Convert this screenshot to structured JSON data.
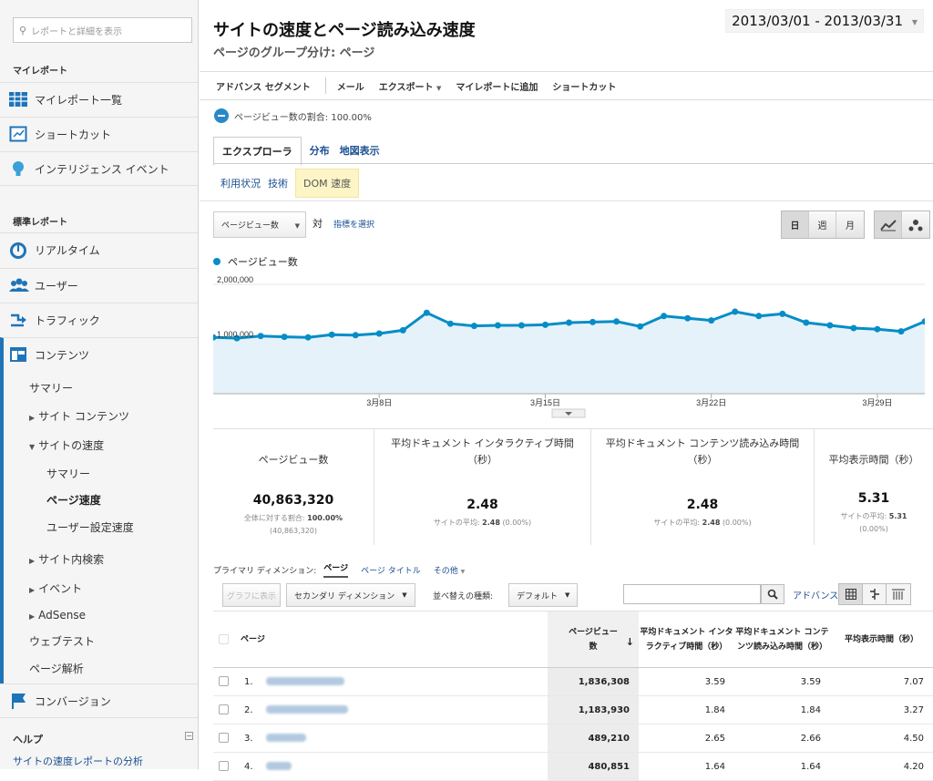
{
  "sidebar": {
    "search_placeholder": "レポートと詳細を表示",
    "my_reports_header": "マイレポート",
    "my_reports_items": [
      {
        "label": "マイレポート一覧"
      },
      {
        "label": "ショートカット"
      },
      {
        "label": "インテリジェンス イベント"
      }
    ],
    "standard_header": "標準レポート",
    "standard_items": [
      {
        "label": "リアルタイム"
      },
      {
        "label": "ユーザー"
      },
      {
        "label": "トラフィック"
      },
      {
        "label": "コンテンツ"
      }
    ],
    "content_sub": {
      "summary": "サマリー",
      "site_content": "サイト コンテンツ",
      "site_speed": "サイトの速度",
      "speed_summary": "サマリー",
      "page_speed": "ページ速度",
      "user_timings": "ユーザー設定速度",
      "site_search": "サイト内検索",
      "events": "イベント",
      "adsense": "AdSense",
      "experiments": "ウェブテスト",
      "inpage": "ページ解析"
    },
    "conversions": "コンバージョン",
    "help_header": "ヘルプ",
    "help_link": "サイトの速度レポートの分析"
  },
  "header": {
    "title": "サイトの速度とページ読み込み速度",
    "subtitle": "ページのグループ分け: ページ",
    "date_range": "2013/03/01 - 2013/03/31"
  },
  "toolbar": {
    "advanced_segments": "アドバンス セグメント",
    "email": "メール",
    "export": "エクスポート",
    "add_to_dashboard": "マイレポートに追加",
    "shortcut": "ショートカット"
  },
  "segment_line": "ページビュー数の割合: 100.00%",
  "tabs": [
    "エクスプローラ",
    "分布",
    "地図表示"
  ],
  "subtabs": [
    "利用状況",
    "技術",
    "DOM 速度"
  ],
  "metric_select": "ページビュー数",
  "vs_label": "対",
  "select_metric": "指標を選択",
  "period_buttons": [
    "日",
    "週",
    "月"
  ],
  "legend_label": "ページビュー数",
  "chart_data": {
    "type": "area",
    "series": [
      {
        "name": "ページビュー数",
        "values": [
          1030000,
          1015000,
          1055000,
          1040000,
          1030000,
          1080000,
          1070000,
          1100000,
          1160000,
          1480000,
          1280000,
          1240000,
          1250000,
          1250000,
          1260000,
          1300000,
          1310000,
          1320000,
          1230000,
          1420000,
          1380000,
          1340000,
          1500000,
          1420000,
          1460000,
          1300000,
          1250000,
          1200000,
          1180000,
          1140000,
          1320000
        ]
      }
    ],
    "x_ticks": [
      "3月8日",
      "3月15日",
      "3月22日",
      "3月29日"
    ],
    "y_ticks": [
      "2,000,000",
      "1,000,000"
    ],
    "ylim": [
      0,
      2000000
    ],
    "color": "#058dc7",
    "fill": "#e6f2fa"
  },
  "summary": [
    {
      "label": "ページビュー数",
      "value": "40,863,320",
      "note1_prefix": "全体に対する割合:",
      "note1_bold": "100.00%",
      "note2": "(40,863,320)"
    },
    {
      "label": "平均ドキュメント インタラクティブ時間（秒）",
      "value": "2.48",
      "note1_prefix": "サイトの平均:",
      "note1_bold": "2.48",
      "note2": "(0.00%)"
    },
    {
      "label": "平均ドキュメント コンテンツ読み込み時間（秒）",
      "value": "2.48",
      "note1_prefix": "サイトの平均:",
      "note1_bold": "2.48",
      "note2": "(0.00%)"
    },
    {
      "label": "平均表示時間（秒）",
      "value": "5.31",
      "note1_prefix": "サイトの平均:",
      "note1_bold": "5.31",
      "note2": "(0.00%)"
    }
  ],
  "dimension": {
    "label": "プライマリ ディメンション:",
    "current": "ページ",
    "page_title": "ページ タイトル",
    "other": "その他"
  },
  "table_controls": {
    "plot_rows": "グラフに表示",
    "secondary_dim": "セカンダリ ディメンション",
    "sort_label": "並べ替えの種類:",
    "sort_value": "デフォルト",
    "advanced": "アドバンス"
  },
  "table": {
    "headers": [
      "ページ",
      "ページビュー数",
      "平均ドキュメント インタラクティブ時間（秒）",
      "平均ドキュメント コンテンツ読み込み時間（秒）",
      "平均表示時間（秒）"
    ],
    "rows": [
      {
        "n": "1.",
        "pv": "1,836,308",
        "di": "3.59",
        "dc": "3.59",
        "lt": "7.07"
      },
      {
        "n": "2.",
        "pv": "1,183,930",
        "di": "1.84",
        "dc": "1.84",
        "lt": "3.27"
      },
      {
        "n": "3.",
        "pv": "489,210",
        "di": "2.65",
        "dc": "2.66",
        "lt": "4.50"
      },
      {
        "n": "4.",
        "pv": "480,851",
        "di": "1.64",
        "dc": "1.64",
        "lt": "4.20"
      }
    ]
  }
}
